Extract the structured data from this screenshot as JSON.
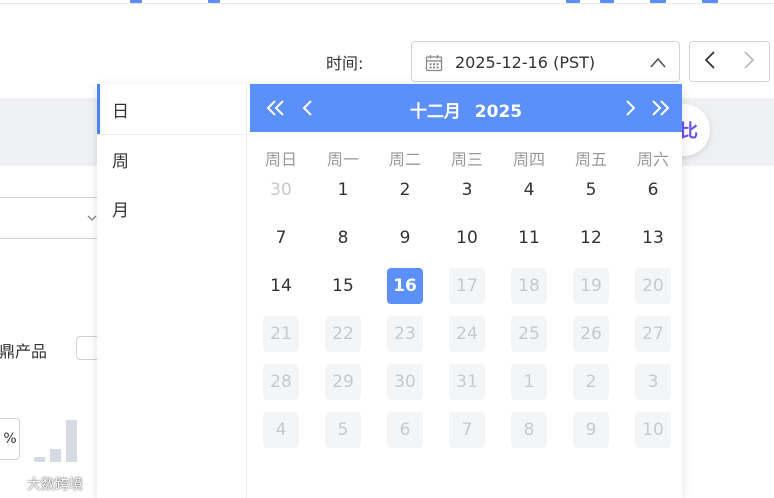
{
  "header": {
    "time_label": "时间:",
    "date_value": "2025-12-16 (PST)",
    "prev_icon": "chevron-left-icon",
    "next_icon": "chevron-right-icon",
    "calendar_icon": "calendar-icon",
    "collapse_icon": "chevron-up-icon"
  },
  "background": {
    "compare_text": "比",
    "product_label": "同鼎产品",
    "percent_label": "%",
    "mini_bar_levels": [
      0.12,
      0.32,
      1.0
    ],
    "watermark": "大数跨境"
  },
  "popup": {
    "modes": [
      "日",
      "周",
      "月"
    ],
    "active_mode": "日",
    "calendar": {
      "month_label": "十二月",
      "year_label": "2025",
      "weekdays": [
        "周日",
        "周一",
        "周二",
        "周三",
        "周四",
        "周五",
        "周六"
      ],
      "weeks": [
        [
          {
            "d": "30",
            "s": "other"
          },
          {
            "d": "1",
            "s": "normal"
          },
          {
            "d": "2",
            "s": "normal"
          },
          {
            "d": "3",
            "s": "normal"
          },
          {
            "d": "4",
            "s": "normal"
          },
          {
            "d": "5",
            "s": "normal"
          },
          {
            "d": "6",
            "s": "normal"
          }
        ],
        [
          {
            "d": "7",
            "s": "normal"
          },
          {
            "d": "8",
            "s": "normal"
          },
          {
            "d": "9",
            "s": "normal"
          },
          {
            "d": "10",
            "s": "normal"
          },
          {
            "d": "11",
            "s": "normal"
          },
          {
            "d": "12",
            "s": "normal"
          },
          {
            "d": "13",
            "s": "normal"
          }
        ],
        [
          {
            "d": "14",
            "s": "normal"
          },
          {
            "d": "15",
            "s": "normal"
          },
          {
            "d": "16",
            "s": "selected"
          },
          {
            "d": "17",
            "s": "disabled"
          },
          {
            "d": "18",
            "s": "disabled"
          },
          {
            "d": "19",
            "s": "disabled"
          },
          {
            "d": "20",
            "s": "disabled"
          }
        ],
        [
          {
            "d": "21",
            "s": "disabled"
          },
          {
            "d": "22",
            "s": "disabled"
          },
          {
            "d": "23",
            "s": "disabled"
          },
          {
            "d": "24",
            "s": "disabled"
          },
          {
            "d": "25",
            "s": "disabled"
          },
          {
            "d": "26",
            "s": "disabled"
          },
          {
            "d": "27",
            "s": "disabled"
          }
        ],
        [
          {
            "d": "28",
            "s": "disabled"
          },
          {
            "d": "29",
            "s": "disabled"
          },
          {
            "d": "30",
            "s": "disabled"
          },
          {
            "d": "31",
            "s": "disabled"
          },
          {
            "d": "1",
            "s": "disabled"
          },
          {
            "d": "2",
            "s": "disabled"
          },
          {
            "d": "3",
            "s": "disabled"
          }
        ],
        [
          {
            "d": "4",
            "s": "disabled"
          },
          {
            "d": "5",
            "s": "disabled"
          },
          {
            "d": "6",
            "s": "disabled"
          },
          {
            "d": "7",
            "s": "disabled"
          },
          {
            "d": "8",
            "s": "disabled"
          },
          {
            "d": "9",
            "s": "disabled"
          },
          {
            "d": "10",
            "s": "disabled"
          }
        ]
      ],
      "nav_icons": {
        "prev_year": "double-chevron-left-icon",
        "prev_month": "chevron-left-icon",
        "next_month": "chevron-right-icon",
        "next_year": "double-chevron-right-icon"
      }
    }
  },
  "colors": {
    "accent": "#5b8ff9",
    "disabled_bg": "#f4f5f7",
    "compare_text": "#6a4ef0"
  }
}
